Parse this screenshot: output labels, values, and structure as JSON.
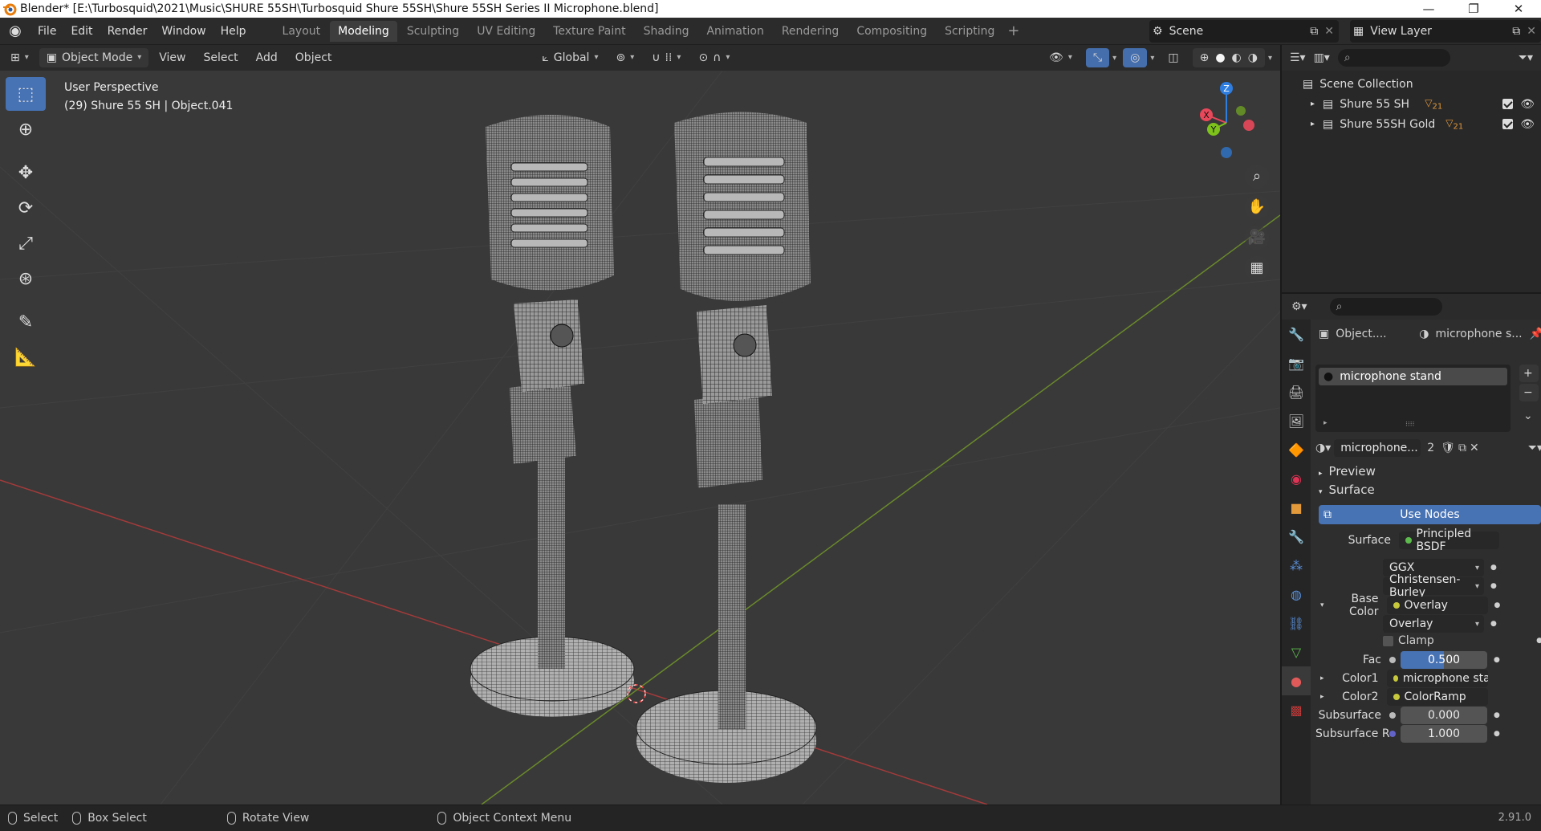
{
  "window": {
    "title": "Blender* [E:\\Turbosquid\\2021\\Music\\SHURE 55SH\\Turbosquid Shure 55SH\\Shure 55SH Series II Microphone.blend]",
    "controls": [
      "—",
      "❐",
      "✕"
    ]
  },
  "menubar": {
    "menus": [
      "File",
      "Edit",
      "Render",
      "Window",
      "Help"
    ],
    "workspaces": [
      "Layout",
      "Modeling",
      "Sculpting",
      "UV Editing",
      "Texture Paint",
      "Shading",
      "Animation",
      "Rendering",
      "Compositing",
      "Scripting"
    ],
    "active_workspace": "Modeling",
    "scene": "Scene",
    "view_layer": "View Layer"
  },
  "viewport_header": {
    "mode": "Object Mode",
    "menus": [
      "View",
      "Select",
      "Add",
      "Object"
    ],
    "transform_orientation": "Global"
  },
  "viewport": {
    "perspective": "User Perspective",
    "object_info": "(29) Shure 55 SH | Object.041",
    "gizmo_axes": [
      "X",
      "Y",
      "Z"
    ],
    "axis_colors": {
      "x": "#e9485a",
      "y": "#7ec21c",
      "z": "#2e7de0"
    }
  },
  "toolbar": {
    "tools": [
      "select-box",
      "cursor",
      "move",
      "rotate",
      "scale",
      "transform",
      "annotate",
      "measure"
    ]
  },
  "outliner": {
    "root": "Scene Collection",
    "collections": [
      {
        "name": "Shure 55 SH",
        "badge": "21"
      },
      {
        "name": "Shure 55SH Gold",
        "badge": "21"
      }
    ]
  },
  "properties": {
    "breadcrumb_object": "Object....",
    "breadcrumb_material": "microphone s...",
    "material_slot": "microphone stand",
    "material_name": "microphone...",
    "users": "2",
    "sections": {
      "preview": "Preview",
      "surface": "Surface"
    },
    "use_nodes": "Use Nodes",
    "rows": [
      {
        "label": "Surface",
        "value": "Principled BSDF",
        "dot": "#5dbb4d"
      },
      {
        "label": "",
        "value": "GGX"
      },
      {
        "label": "",
        "value": "Christensen-Burley"
      },
      {
        "label": "Base Color",
        "value": "Overlay",
        "dot": "#c8c83c"
      },
      {
        "label": "",
        "value": "Overlay"
      },
      {
        "label": "",
        "value": "Clamp"
      },
      {
        "label": "Fac",
        "value": "0.500"
      },
      {
        "label": "Color1",
        "value": "microphone stand_",
        "dot": "#c8c83c"
      },
      {
        "label": "Color2",
        "value": "ColorRamp",
        "dot": "#c8c83c"
      },
      {
        "label": "Subsurface",
        "value": "0.000"
      },
      {
        "label": "Subsurface R",
        "value": "1.000"
      }
    ],
    "fac_fraction": 0.5
  },
  "statusbar": {
    "items": [
      "Select",
      "Box Select",
      "Rotate View",
      "Object Context Menu"
    ],
    "version": "2.91.0"
  }
}
